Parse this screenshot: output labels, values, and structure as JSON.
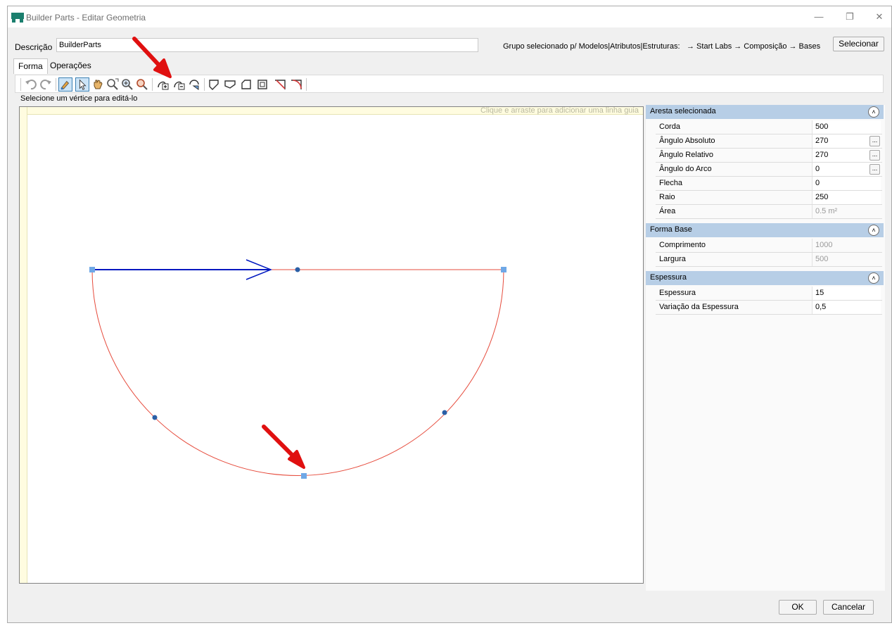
{
  "window": {
    "title": "Builder Parts - Editar Geometria"
  },
  "description": {
    "label": "Descrição",
    "value": "BuilderParts"
  },
  "group": {
    "label": "Grupo selecionado p/ Modelos|Atributos|Estruturas:",
    "path": "→ Start Labs → Composição → Bases",
    "select_button": "Selecionar"
  },
  "tabs": [
    {
      "label": "Forma",
      "active": true
    },
    {
      "label": "Operações",
      "active": false
    }
  ],
  "toolbar": {
    "icons": [
      "undo-icon",
      "redo-icon",
      "edit-vertex-icon",
      "select-pointer-icon",
      "pan-hand-icon",
      "zoom-extents-icon",
      "zoom-in-icon",
      "zoom-out-icon",
      "add-vertex-icon",
      "remove-vertex-icon",
      "rotate-icon",
      "shape-a-icon",
      "shape-b-icon",
      "shape-c-icon",
      "shape-d-icon",
      "cut-corner-icon",
      "round-corner-icon"
    ]
  },
  "hint": "Selecione um vértice para editá-lo",
  "canvas": {
    "guide_hint": "Clique e arraste para adicionar uma linha guia"
  },
  "panel": {
    "edge_section": {
      "title": "Aresta selecionada",
      "rows": [
        {
          "name": "Corda",
          "value": "500"
        },
        {
          "name": "Ângulo Absoluto",
          "value": "270"
        },
        {
          "name": "Ângulo Relativo",
          "value": "270"
        },
        {
          "name": "Ângulo do Arco",
          "value": "0"
        },
        {
          "name": "Flecha",
          "value": "0"
        },
        {
          "name": "Raio",
          "value": "250"
        },
        {
          "name": "Área",
          "value": "0.5 m²"
        }
      ]
    },
    "base_section": {
      "title": "Forma Base",
      "rows": [
        {
          "name": "Comprimento",
          "value": "1000"
        },
        {
          "name": "Largura",
          "value": "500"
        }
      ]
    },
    "thickness_section": {
      "title": "Espessura",
      "rows": [
        {
          "name": "Espessura",
          "value": "15"
        },
        {
          "name": "Variação da Espessura",
          "value": "0,5"
        }
      ]
    }
  },
  "buttons": {
    "ok": "OK",
    "cancel": "Cancelar"
  },
  "colors": {
    "shape_edge": "#e64b3c",
    "selected_edge": "#0018c0",
    "vertex": "#6fa8e6",
    "annotation_arrow": "#e01010",
    "section_header": "#b7cee6"
  }
}
